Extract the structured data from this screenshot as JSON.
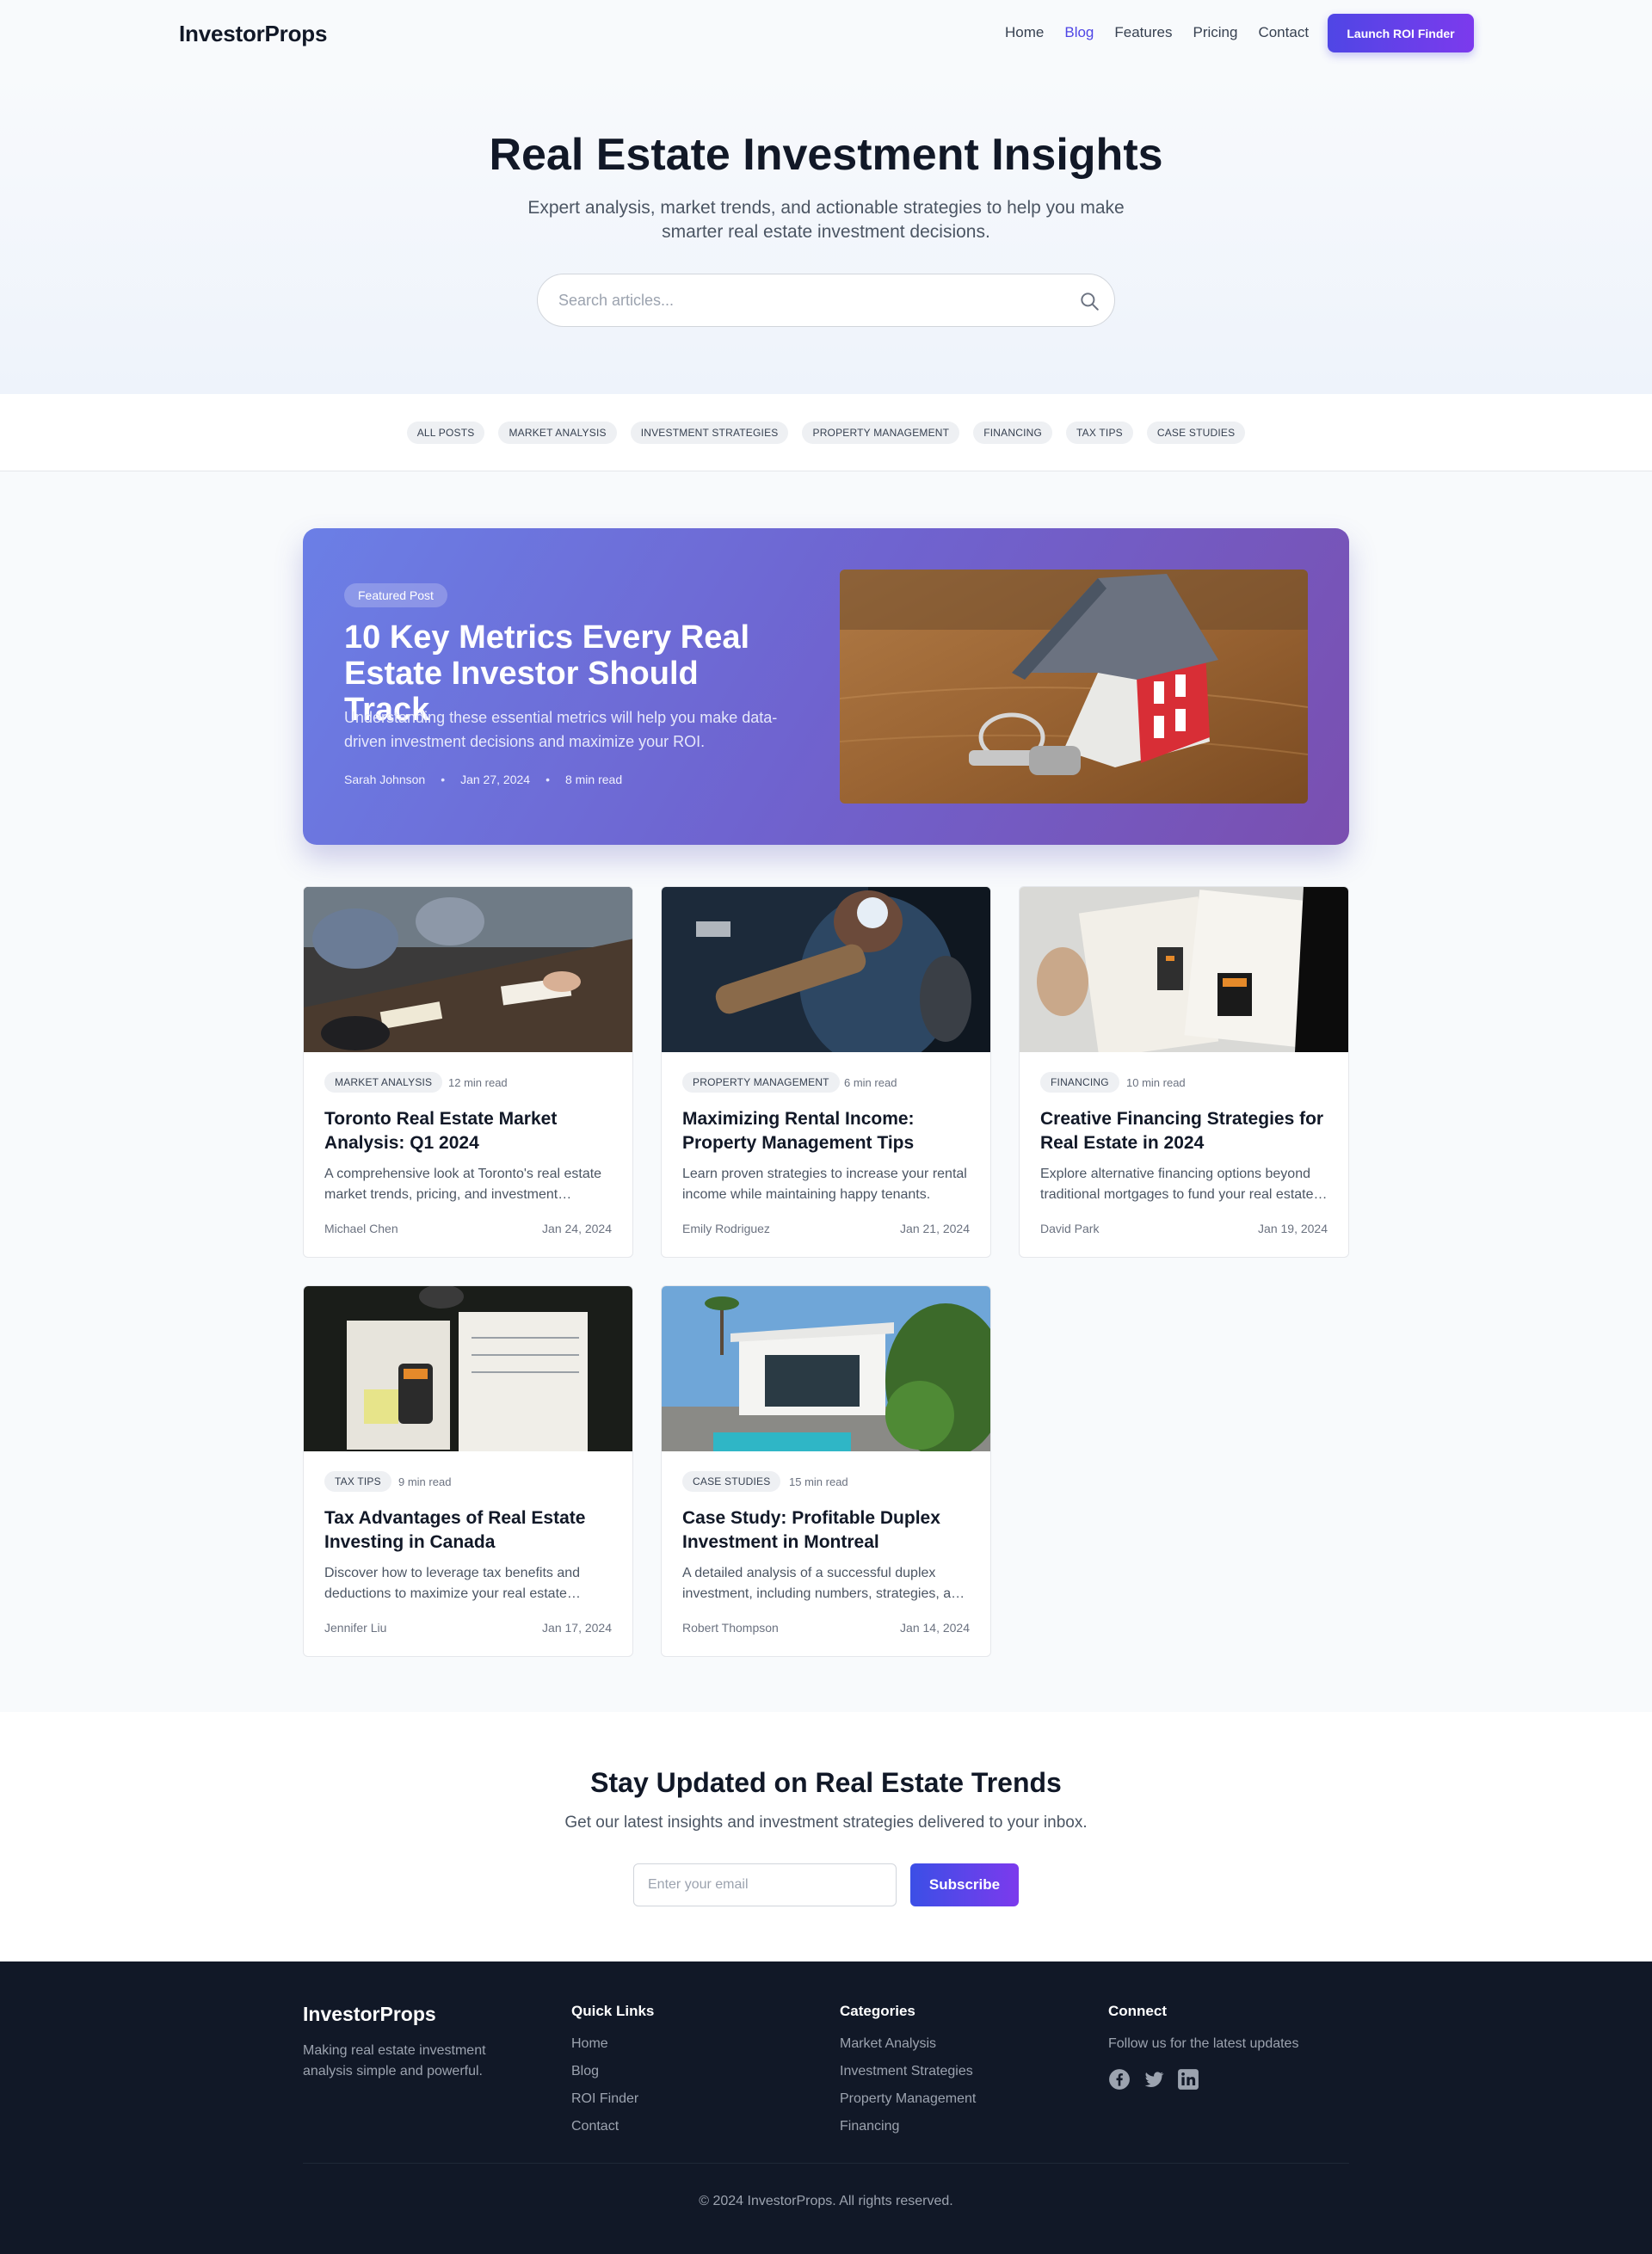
{
  "header": {
    "brand": "InvestorProps",
    "nav": [
      "Home",
      "Blog",
      "Features",
      "Pricing",
      "Contact"
    ],
    "active_nav": "Blog",
    "cta": "Launch ROI Finder"
  },
  "hero": {
    "title": "Real Estate Investment Insights",
    "subtitle": "Expert analysis, market trends, and actionable strategies to help you make smarter real estate investment decisions.",
    "search_placeholder": "Search articles..."
  },
  "categories": [
    "All Posts",
    "Market Analysis",
    "Investment Strategies",
    "Property Management",
    "Financing",
    "Tax Tips",
    "Case Studies"
  ],
  "featured": {
    "badge": "Featured Post",
    "title": "10 Key Metrics Every Real Estate Investor Should Track",
    "description": "Understanding these essential metrics will help you make data-driven investment decisions and maximize your ROI.",
    "author": "Sarah Johnson",
    "date": "Jan 27, 2024",
    "read_time": "8 min read"
  },
  "posts": [
    {
      "tag": "Market Analysis",
      "read_time": "12 min read",
      "title": "Toronto Real Estate Market Analysis: Q1 2024",
      "description": "A comprehensive look at Toronto's real estate market trends, pricing, and investment opportunities.",
      "author": "Michael Chen",
      "date": "Jan 24, 2024"
    },
    {
      "tag": "Property Management",
      "read_time": "6 min read",
      "title": "Maximizing Rental Income: Property Management Tips",
      "description": "Learn proven strategies to increase your rental income while maintaining happy tenants.",
      "author": "Emily Rodriguez",
      "date": "Jan 21, 2024"
    },
    {
      "tag": "Financing",
      "read_time": "10 min read",
      "title": "Creative Financing Strategies for Real Estate in 2024",
      "description": "Explore alternative financing options beyond traditional mortgages to fund your real estate deals.",
      "author": "David Park",
      "date": "Jan 19, 2024"
    },
    {
      "tag": "Tax Tips",
      "read_time": "9 min read",
      "title": "Tax Advantages of Real Estate Investing in Canada",
      "description": "Discover how to leverage tax benefits and deductions to maximize your real estate returns.",
      "author": "Jennifer Liu",
      "date": "Jan 17, 2024"
    },
    {
      "tag": "Case Studies",
      "read_time": "15 min read",
      "title": "Case Study: Profitable Duplex Investment in Montreal",
      "description": "A detailed analysis of a successful duplex investment, including numbers, strategies, and lessons.",
      "author": "Robert Thompson",
      "date": "Jan 14, 2024"
    }
  ],
  "newsletter": {
    "title": "Stay Updated on Real Estate Trends",
    "subtitle": "Get our latest insights and investment strategies delivered to your inbox.",
    "placeholder": "Enter your email",
    "button": "Subscribe"
  },
  "footer": {
    "brand": "InvestorProps",
    "tagline": "Making real estate investment analysis simple and powerful.",
    "quick_links_title": "Quick Links",
    "quick_links": [
      "Home",
      "Blog",
      "ROI Finder",
      "Contact"
    ],
    "categories_title": "Categories",
    "categories": [
      "Market Analysis",
      "Investment Strategies",
      "Property Management",
      "Financing"
    ],
    "connect_title": "Connect",
    "connect_text": "Follow us for the latest updates",
    "social_icons": [
      "facebook-icon",
      "twitter-icon",
      "linkedin-icon"
    ],
    "copyright": "© 2024 InvestorProps. All rights reserved."
  },
  "colors": {
    "accent": "#4f46e5",
    "accent_purple": "#7c3aed",
    "footer_bg": "#111827"
  }
}
